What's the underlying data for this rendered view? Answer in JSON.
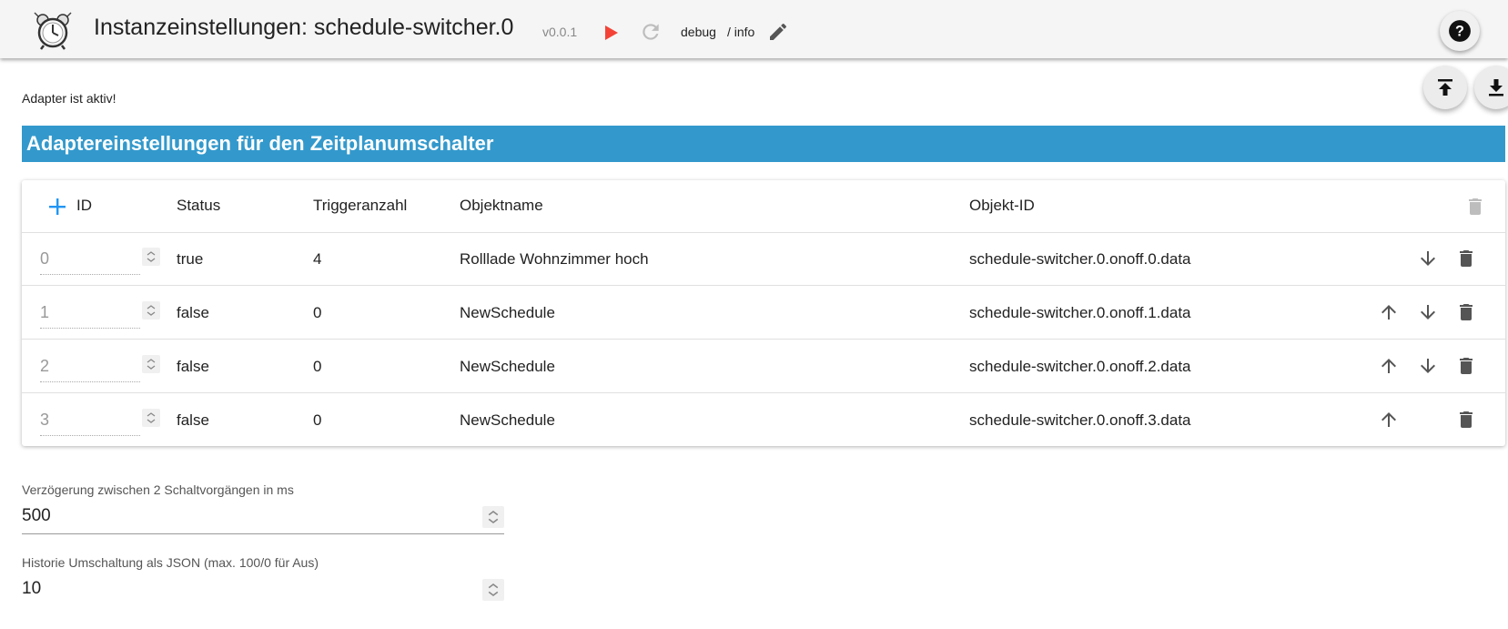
{
  "header": {
    "title": "Instanzeinstellungen: schedule-switcher.0",
    "version": "v0.0.1",
    "log_level": "debug",
    "log_level_config": "/ info",
    "play_color": "#f44336",
    "icons": [
      "alarm-clock-logo",
      "play-icon",
      "reload-icon",
      "pencil-icon",
      "help-icon"
    ]
  },
  "status_text": "Adapter ist aktiv!",
  "section": {
    "title": "Adaptereinstellungen für den Zeitplanumschalter",
    "color": "#3399cc"
  },
  "table": {
    "columns": [
      "ID",
      "Status",
      "Triggeranzahl",
      "Objektname",
      "Objekt-ID"
    ],
    "rows": [
      {
        "id": "0",
        "status": "true",
        "triggers": "4",
        "name": "Rolllade Wohnzimmer hoch",
        "object_id": "schedule-switcher.0.onoff.0.data"
      },
      {
        "id": "1",
        "status": "false",
        "triggers": "0",
        "name": "NewSchedule",
        "object_id": "schedule-switcher.0.onoff.1.data"
      },
      {
        "id": "2",
        "status": "false",
        "triggers": "0",
        "name": "NewSchedule",
        "object_id": "schedule-switcher.0.onoff.2.data"
      },
      {
        "id": "3",
        "status": "false",
        "triggers": "0",
        "name": "NewSchedule",
        "object_id": "schedule-switcher.0.onoff.3.data"
      }
    ]
  },
  "fields": {
    "delay_label": "Verzögerung zwischen 2 Schaltvorgängen in ms",
    "delay_value": "500",
    "history_label": "Historie Umschaltung als JSON (max. 100/0 für Aus)",
    "history_value": "10"
  }
}
